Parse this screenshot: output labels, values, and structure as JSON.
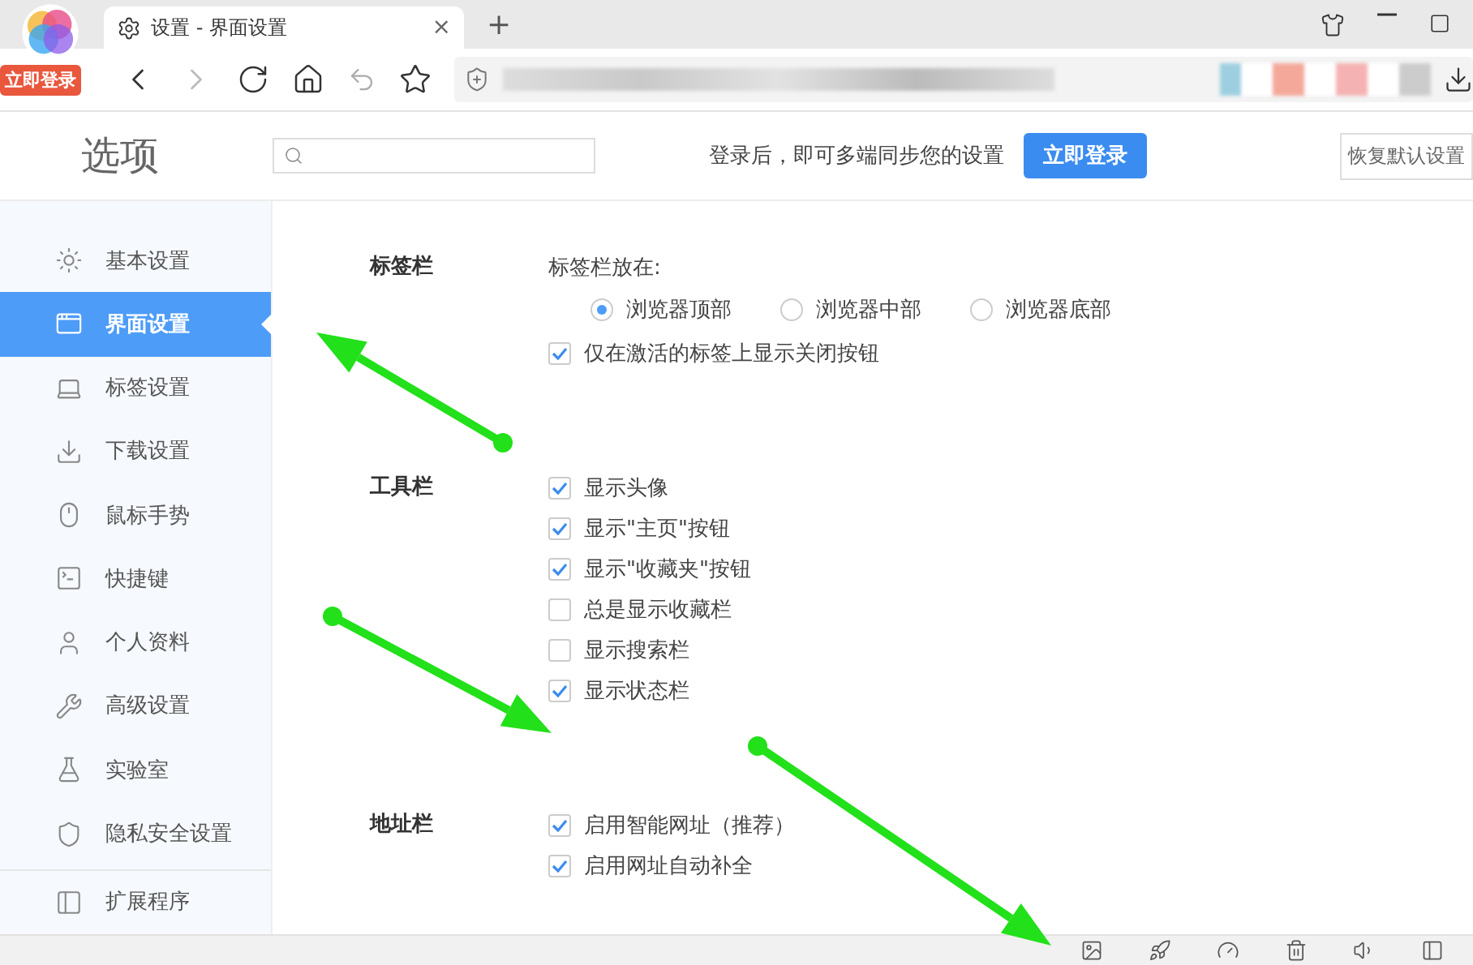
{
  "browser": {
    "login_badge": "立即登录",
    "tab": {
      "title": "设置 - 界面设置",
      "close": "×"
    },
    "new_tab": "+"
  },
  "header": {
    "title": "选项",
    "login_prompt": "登录后，即可多端同步您的设置",
    "login_button": "立即登录",
    "restore_button": "恢复默认设置"
  },
  "sidebar": {
    "items": [
      {
        "label": "基本设置",
        "selected": false
      },
      {
        "label": "界面设置",
        "selected": true
      },
      {
        "label": "标签设置",
        "selected": false
      },
      {
        "label": "下载设置",
        "selected": false
      },
      {
        "label": "鼠标手势",
        "selected": false
      },
      {
        "label": "快捷键",
        "selected": false
      },
      {
        "label": "个人资料",
        "selected": false
      },
      {
        "label": "高级设置",
        "selected": false
      },
      {
        "label": "实验室",
        "selected": false
      },
      {
        "label": "隐私安全设置",
        "selected": false
      },
      {
        "label": "扩展程序",
        "selected": false
      }
    ]
  },
  "sections": [
    {
      "title": "标签栏",
      "items": [
        {
          "kind": "caption",
          "label": "标签栏放在:"
        },
        {
          "kind": "radio_group",
          "options": [
            {
              "label": "浏览器顶部",
              "selected": true
            },
            {
              "label": "浏览器中部",
              "selected": false
            },
            {
              "label": "浏览器底部",
              "selected": false
            }
          ]
        },
        {
          "kind": "checkbox",
          "label": "仅在激活的标签上显示关闭按钮",
          "checked": true
        }
      ]
    },
    {
      "title": "工具栏",
      "items": [
        {
          "kind": "checkbox",
          "label": "显示头像",
          "checked": true
        },
        {
          "kind": "checkbox",
          "label": "显示\"主页\"按钮",
          "checked": true
        },
        {
          "kind": "checkbox",
          "label": "显示\"收藏夹\"按钮",
          "checked": true
        },
        {
          "kind": "checkbox",
          "label": "总是显示收藏栏",
          "checked": false
        },
        {
          "kind": "checkbox",
          "label": "显示搜索栏",
          "checked": false
        },
        {
          "kind": "checkbox",
          "label": "显示状态栏",
          "checked": true
        }
      ]
    },
    {
      "title": "地址栏",
      "items": [
        {
          "kind": "checkbox",
          "label": "启用智能网址（推荐）",
          "checked": true
        },
        {
          "kind": "checkbox",
          "label": "启用网址自动补全",
          "checked": true
        }
      ]
    }
  ]
}
